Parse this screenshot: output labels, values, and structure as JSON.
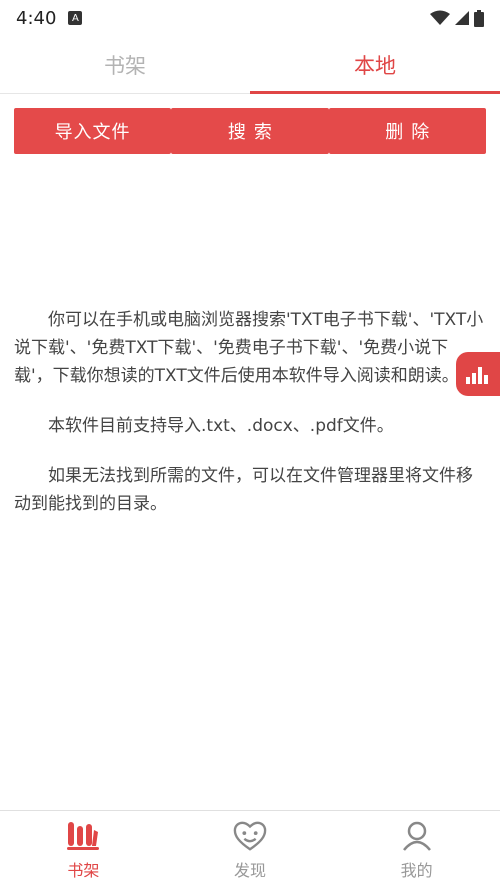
{
  "status_bar": {
    "time": "4:40",
    "app_icon": "A"
  },
  "tabs": [
    {
      "label": "书架",
      "active": false
    },
    {
      "label": "本地",
      "active": true
    }
  ],
  "actions": {
    "import": "导入文件",
    "search": "搜索",
    "delete": "删除"
  },
  "content": {
    "paragraph1": "你可以在手机或电脑浏览器搜索'TXT电子书下载'、'TXT小说下载'、'免费TXT下载'、'免费电子书下载'、'免费小说下载'，下载你想读的TXT文件后使用本软件导入阅读和朗读。",
    "paragraph2": "本软件目前支持导入.txt、.docx、.pdf文件。",
    "paragraph3": "如果无法找到所需的文件，可以在文件管理器里将文件移动到能找到的目录。"
  },
  "bottom_nav": [
    {
      "label": "书架",
      "icon": "bookshelf-icon",
      "active": true
    },
    {
      "label": "发现",
      "icon": "discover-icon",
      "active": false
    },
    {
      "label": "我的",
      "icon": "profile-icon",
      "active": false
    }
  ],
  "colors": {
    "accent": "#e04646",
    "button": "#e44a4a",
    "inactive": "#b3b3b3"
  },
  "float_tab_icon": "audio-bars-icon"
}
